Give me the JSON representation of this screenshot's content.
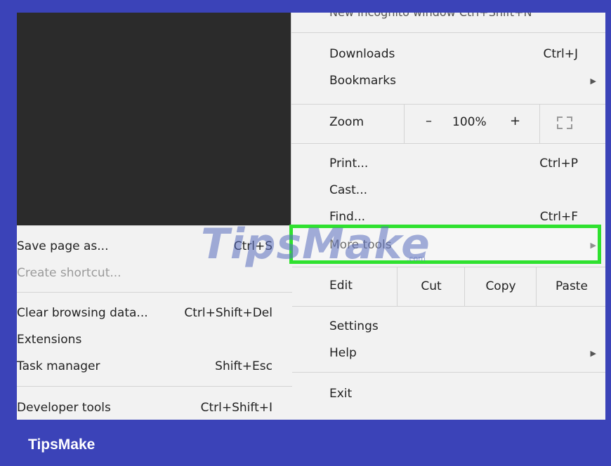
{
  "main_menu": {
    "cut_top_text": "New incognito window    Ctrl+Shift+N",
    "downloads": {
      "label": "Downloads",
      "shortcut": "Ctrl+J"
    },
    "bookmarks": {
      "label": "Bookmarks"
    },
    "zoom": {
      "label": "Zoom",
      "minus": "–",
      "value": "100%",
      "plus": "+"
    },
    "print": {
      "label": "Print...",
      "shortcut": "Ctrl+P"
    },
    "cast": {
      "label": "Cast..."
    },
    "find": {
      "label": "Find...",
      "shortcut": "Ctrl+F"
    },
    "more_tools": {
      "label": "More tools"
    },
    "edit": {
      "label": "Edit",
      "cut": "Cut",
      "copy": "Copy",
      "paste": "Paste"
    },
    "settings": {
      "label": "Settings"
    },
    "help": {
      "label": "Help"
    },
    "exit": {
      "label": "Exit"
    }
  },
  "sub_menu": {
    "save_page": {
      "label": "Save page as...",
      "shortcut": "Ctrl+S"
    },
    "create_shortcut": {
      "label": "Create shortcut..."
    },
    "clear_browsing": {
      "label": "Clear browsing data...",
      "shortcut": "Ctrl+Shift+Del"
    },
    "extensions": {
      "label": "Extensions"
    },
    "task_manager": {
      "label": "Task manager",
      "shortcut": "Shift+Esc"
    },
    "developer_tools": {
      "label": "Developer tools",
      "shortcut": "Ctrl+Shift+I"
    }
  },
  "watermark": {
    "text": "TipsMake",
    "sub": ".com"
  },
  "brand": {
    "text": "TipsMake"
  },
  "colors": {
    "background": "#3b43b8",
    "highlight": "#2fe12f",
    "menu": "#f2f2f2",
    "dark": "#2b2b2b"
  }
}
